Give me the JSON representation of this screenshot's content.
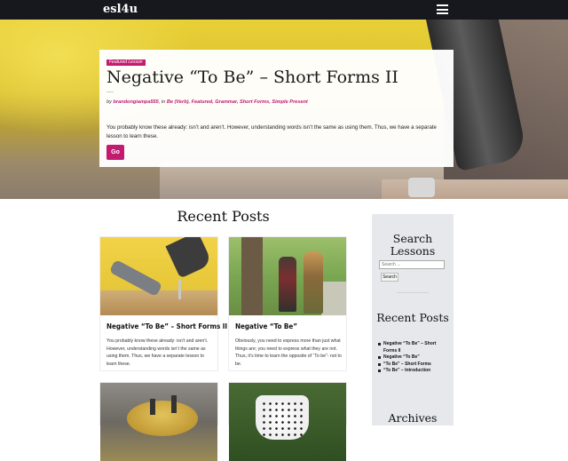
{
  "header": {
    "site_title": "esl4u",
    "menu_icon": "hamburger-icon"
  },
  "hero": {
    "badge": "Featured Lesson",
    "title": "Negative “To Be” – Short Forms II",
    "meta": {
      "by": "by",
      "author": "brandongiampa555",
      "in": ", in",
      "categories": "Be (Verb), Featured, Grammar, Short Forms, Simple Present"
    },
    "excerpt": "You probably know these already: isn’t and aren’t. However, understanding words isn’t the same as using them. Thus, we have a separate lesson to learn these.",
    "go_label": "Go"
  },
  "main": {
    "recent_heading": "Recent Posts",
    "posts": [
      {
        "title": "Negative “To Be” – Short Forms II",
        "excerpt": "You probably know these already: isn’t and aren’t. However, understanding words isn’t the same as using them. Thus, we have a separate lesson to learn these."
      },
      {
        "title": "Negative “To Be”",
        "excerpt": "Obviously, you need to express more than just what things are; you need to express what they are not. Thus, it’s time to learn the opposite of “To be”- not to be."
      }
    ]
  },
  "sidebar": {
    "search_title": "Search Lessons",
    "search_placeholder": "Search ...",
    "search_button": "Search",
    "recent_title": "Recent Posts",
    "recent_items": [
      "Negative “To Be” – Short Forms II",
      "Negative “To Be”",
      "“To Be” – Short Forms",
      "“To Be” – Introduction"
    ],
    "archives_title": "Archives"
  },
  "colors": {
    "accent": "#c21b6f",
    "topbar": "#16181d",
    "sidebar_bg": "#e6e8ec"
  }
}
